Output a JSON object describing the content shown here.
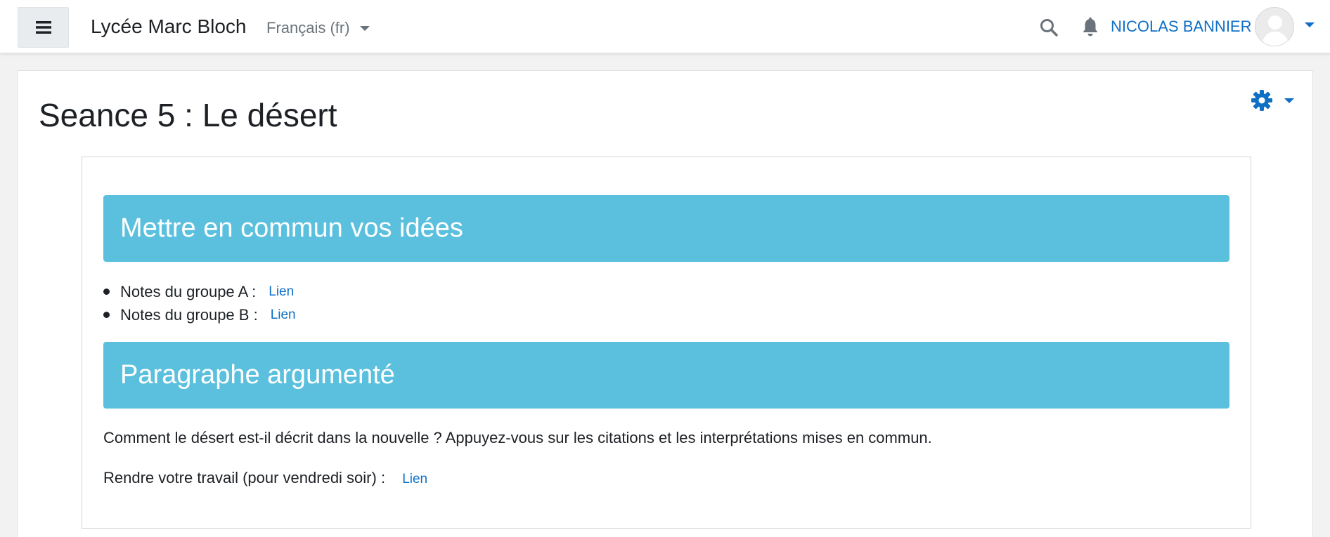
{
  "navbar": {
    "site_name": "Lycée Marc Bloch",
    "language": "Français (fr)",
    "user_name": "NICOLAS BANNIER",
    "icons": [
      "menu-icon",
      "search-icon",
      "bell-icon",
      "avatar-icon",
      "gear-icon"
    ]
  },
  "page": {
    "title": "Seance 5 : Le désert"
  },
  "sections": [
    {
      "heading": "Mettre en commun vos idées"
    },
    {
      "heading": "Paragraphe argumenté"
    }
  ],
  "notes": [
    {
      "label": "Notes du groupe A :",
      "link": "Lien"
    },
    {
      "label": "Notes du groupe B :",
      "link": "Lien"
    }
  ],
  "question": "Comment le désert est-il décrit dans la nouvelle ? Appuyez-vous sur les citations et les interprétations mises en commun.",
  "submit": {
    "label": "Rendre votre travail (pour vendredi soir) :",
    "link": "Lien"
  },
  "colors": {
    "accent": "#0f6fc5",
    "section_header": "#5bc0de"
  }
}
